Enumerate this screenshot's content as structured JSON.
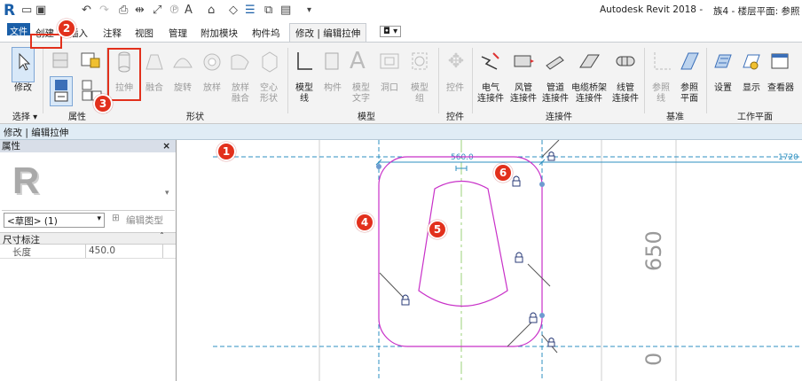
{
  "app": {
    "title": "Autodesk Revit 2018 -",
    "view_title": "族4 - 楼层平面: 参照"
  },
  "ribbon_tabs": [
    "文件",
    "创建",
    "插入",
    "注释",
    "视图",
    "管理",
    "附加模块",
    "构件坞",
    "修改 | 编辑拉伸"
  ],
  "ribbon": {
    "select": {
      "modify": "修改",
      "panel": "选择 ▾"
    },
    "properties": {
      "panel": "属性"
    },
    "shapes": {
      "panel": "形状",
      "items": [
        "拉伸",
        "融合",
        "旋转",
        "放样",
        "放样\n融合",
        "空心\n形状"
      ]
    },
    "model": {
      "panel": "模型",
      "items": [
        "模型\n线",
        "构件",
        "模型\n文字",
        "洞口",
        "模型\n组"
      ]
    },
    "controls": {
      "panel": "控件",
      "items": [
        "控件"
      ]
    },
    "connectors": {
      "panel": "连接件",
      "items": [
        "电气\n连接件",
        "风管\n连接件",
        "管道\n连接件",
        "电缆桥架\n连接件",
        "线管\n连接件"
      ]
    },
    "datum": {
      "panel": "基准",
      "items": [
        "参照\n线",
        "参照\n平面"
      ]
    },
    "workplane": {
      "panel": "工作平面",
      "items": [
        "设置",
        "显示",
        "查看器"
      ]
    }
  },
  "context_bar": "修改 | 编辑拉伸",
  "properties_palette": {
    "title": "属性",
    "type_selector": "<草图> (1)",
    "edit_type": "编辑类型",
    "group": "尺寸标注",
    "rows": [
      {
        "name": "长度",
        "value": "450.0"
      }
    ]
  },
  "canvas": {
    "dim_top": "560.0",
    "dim_right_top": "1720",
    "dim_vertical": "650",
    "dim_vertical_partial": "0"
  },
  "callouts": [
    "1",
    "2",
    "3",
    "4",
    "5",
    "6"
  ],
  "colors": {
    "accent": "#e2301c",
    "sketch": "#c830c8",
    "reference": "#2c8fc0"
  }
}
